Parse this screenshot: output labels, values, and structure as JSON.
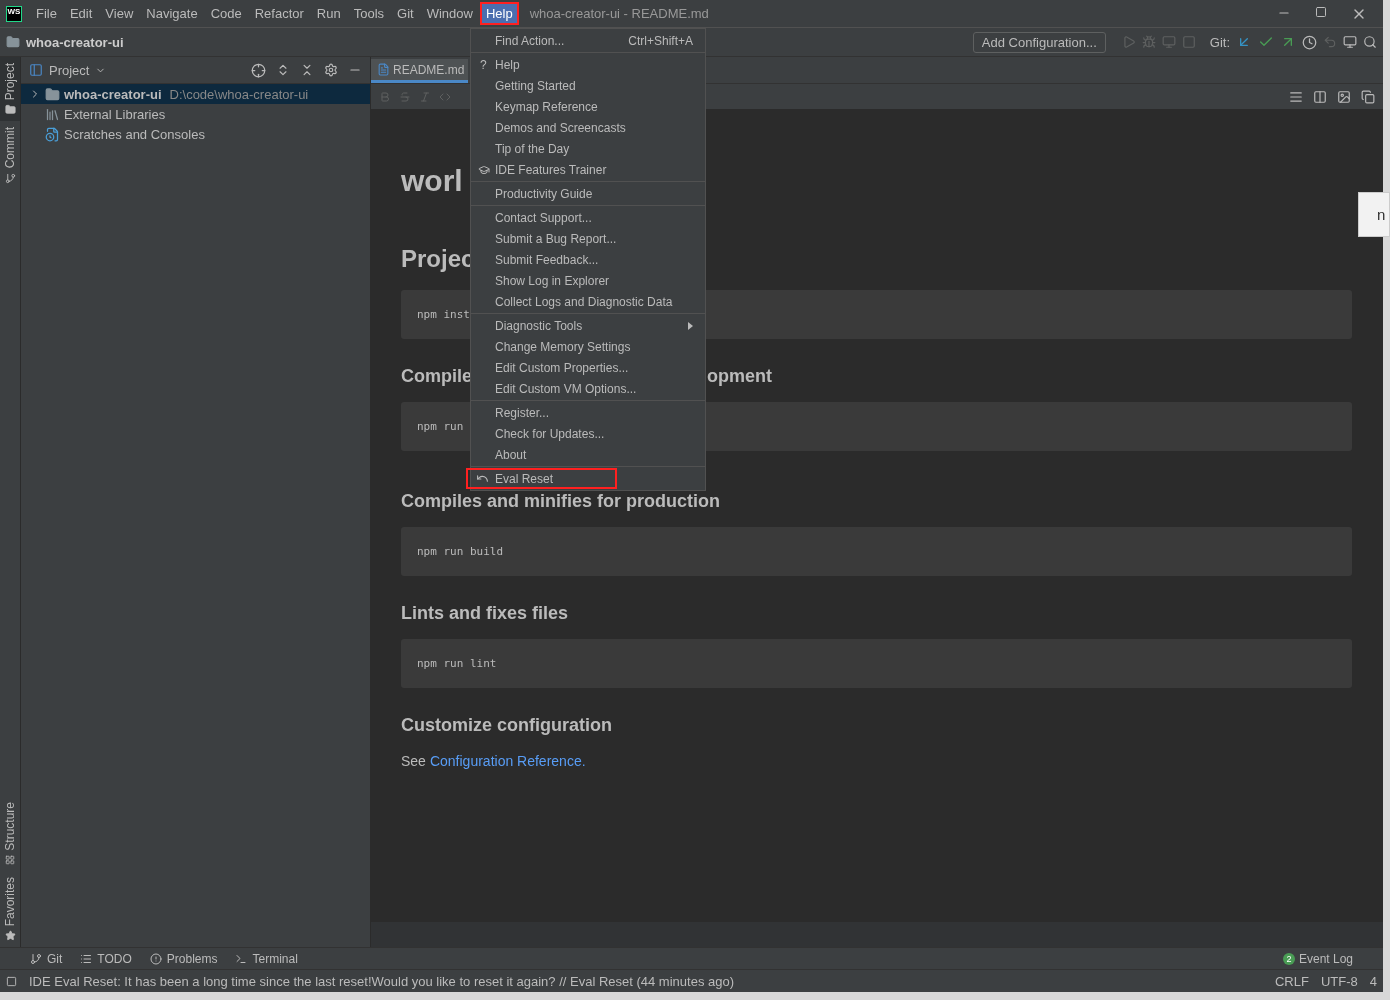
{
  "window": {
    "app_icon": "WS",
    "title": "whoa-creator-ui - README.md"
  },
  "menu_bar": [
    {
      "label": "File",
      "selected": false,
      "highlighted": false
    },
    {
      "label": "Edit",
      "selected": false,
      "highlighted": false
    },
    {
      "label": "View",
      "selected": false,
      "highlighted": false
    },
    {
      "label": "Navigate",
      "selected": false,
      "highlighted": false
    },
    {
      "label": "Code",
      "selected": false,
      "highlighted": false
    },
    {
      "label": "Refactor",
      "selected": false,
      "highlighted": false
    },
    {
      "label": "Run",
      "selected": false,
      "highlighted": false
    },
    {
      "label": "Tools",
      "selected": false,
      "highlighted": false
    },
    {
      "label": "Git",
      "selected": false,
      "highlighted": false
    },
    {
      "label": "Window",
      "selected": false,
      "highlighted": false
    },
    {
      "label": "Help",
      "selected": true,
      "highlighted": true
    }
  ],
  "nav_bar": {
    "project": "whoa-creator-ui",
    "config_button": "Add Configuration...",
    "git_label": "Git:"
  },
  "left_stripe": {
    "top": [
      {
        "label": "Project",
        "selected": true
      },
      {
        "label": "Commit",
        "selected": false
      }
    ],
    "bottom": [
      {
        "label": "Structure",
        "selected": false
      },
      {
        "label": "Favorites",
        "selected": false
      }
    ]
  },
  "project_panel": {
    "title": "Project",
    "tree": [
      {
        "kind": "folder",
        "label": "whoa-creator-ui",
        "path": "D:\\code\\whoa-creator-ui",
        "selected": true
      },
      {
        "kind": "libraries",
        "label": "External Libraries",
        "selected": false
      },
      {
        "kind": "scratches",
        "label": "Scratches and Consoles",
        "selected": false
      }
    ]
  },
  "editor": {
    "tab": "README.md",
    "preview": [
      {
        "kind": "h1",
        "text": "worl"
      },
      {
        "kind": "h2",
        "text": "Projec"
      },
      {
        "kind": "code",
        "text": "npm inst"
      },
      {
        "kind": "h3",
        "text": "Compile",
        "right": "opment"
      },
      {
        "kind": "code",
        "text": "npm run"
      },
      {
        "kind": "h3",
        "text": "Compiles and minifies for production"
      },
      {
        "kind": "code",
        "text": "npm run build"
      },
      {
        "kind": "h3",
        "text": "Lints and fixes files"
      },
      {
        "kind": "code",
        "text": "npm run lint"
      },
      {
        "kind": "h3",
        "text": "Customize configuration"
      },
      {
        "kind": "p",
        "text": "See",
        "link": "Configuration Reference."
      }
    ]
  },
  "help_menu": {
    "groups": [
      [
        {
          "kind": "plain",
          "label": "Find Action...",
          "shortcut": "Ctrl+Shift+A",
          "highlighted": false
        }
      ],
      [
        {
          "kind": "help",
          "icon_text": "?",
          "label": "Help",
          "highlighted": false
        },
        {
          "kind": "plain",
          "label": "Getting Started",
          "highlighted": false
        },
        {
          "kind": "plain",
          "label": "Keymap Reference",
          "highlighted": false
        },
        {
          "kind": "plain",
          "label": "Demos and Screencasts",
          "highlighted": false
        },
        {
          "kind": "plain",
          "label": "Tip of the Day",
          "highlighted": false
        },
        {
          "kind": "trainer",
          "label": "IDE Features Trainer",
          "highlighted": false
        }
      ],
      [
        {
          "kind": "plain",
          "label": "Productivity Guide",
          "highlighted": false
        }
      ],
      [
        {
          "kind": "plain",
          "label": "Contact Support...",
          "highlighted": false
        },
        {
          "kind": "plain",
          "label": "Submit a Bug Report...",
          "highlighted": false
        },
        {
          "kind": "plain",
          "label": "Submit Feedback...",
          "highlighted": false
        },
        {
          "kind": "plain",
          "label": "Show Log in Explorer",
          "highlighted": false
        },
        {
          "kind": "plain",
          "label": "Collect Logs and Diagnostic Data",
          "highlighted": false
        }
      ],
      [
        {
          "kind": "submenu",
          "label": "Diagnostic Tools",
          "highlighted": false
        },
        {
          "kind": "plain",
          "label": "Change Memory Settings",
          "highlighted": false
        },
        {
          "kind": "plain",
          "label": "Edit Custom Properties...",
          "highlighted": false
        },
        {
          "kind": "plain",
          "label": "Edit Custom VM Options...",
          "highlighted": false
        }
      ],
      [
        {
          "kind": "plain",
          "label": "Register...",
          "highlighted": false
        },
        {
          "kind": "plain",
          "label": "Check for Updates...",
          "highlighted": false
        },
        {
          "kind": "plain",
          "label": "About",
          "highlighted": false
        }
      ],
      [
        {
          "kind": "reset",
          "label": "Eval Reset",
          "highlighted": true
        }
      ]
    ]
  },
  "tool_windows": [
    {
      "kind": "git",
      "label": "Git"
    },
    {
      "kind": "todo",
      "label": "TODO"
    },
    {
      "kind": "problems",
      "label": "Problems"
    },
    {
      "kind": "terminal",
      "label": "Terminal"
    }
  ],
  "event_log": {
    "badge": "2",
    "label": "Event Log"
  },
  "status_bar": {
    "message": "IDE Eval Reset: It has been a long time since the last reset!Would you like to reset it again? // Eval Reset (44 minutes ago)",
    "items": [
      "CRLF",
      "UTF-8",
      "4"
    ]
  },
  "desktop_popup": {
    "text": "n"
  }
}
